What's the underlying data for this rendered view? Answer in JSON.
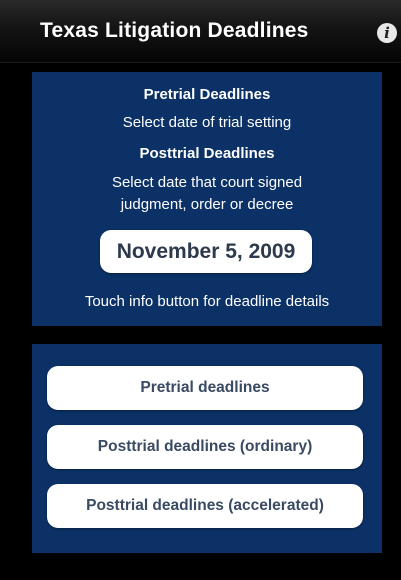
{
  "header": {
    "title": "Texas Litigation Deadlines",
    "info_icon": "info-icon",
    "info_glyph": "i"
  },
  "info_panel": {
    "pretrial_heading": "Pretrial Deadlines",
    "pretrial_instruction": "Select date of trial setting",
    "posttrial_heading": "Posttrial Deadlines",
    "posttrial_instruction_line1": "Select date that court signed",
    "posttrial_instruction_line2": "judgment, order or decree",
    "selected_date": "November 5, 2009",
    "hint": "Touch info button for deadline details"
  },
  "buttons": {
    "pretrial": "Pretrial deadlines",
    "posttrial_ordinary": "Posttrial deadlines (ordinary)",
    "posttrial_accelerated": "Posttrial deadlines (accelerated)"
  },
  "colors": {
    "background": "#000000",
    "panel": "#0b3166",
    "button_bg": "#ffffff",
    "button_text": "#3a4a63"
  }
}
